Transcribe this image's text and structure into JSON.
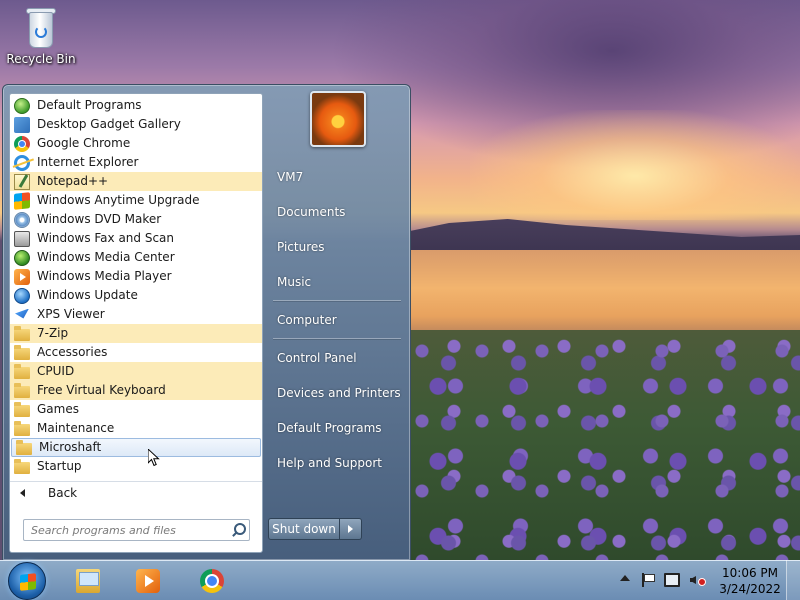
{
  "desktop": {
    "recycle_bin_label": "Recycle Bin"
  },
  "start_menu": {
    "programs": [
      {
        "label": "Default Programs",
        "icon": "default-programs-icon",
        "highlight": false
      },
      {
        "label": "Desktop Gadget Gallery",
        "icon": "gadget-gallery-icon",
        "highlight": false
      },
      {
        "label": "Google Chrome",
        "icon": "chrome-icon",
        "highlight": false
      },
      {
        "label": "Internet Explorer",
        "icon": "internet-explorer-icon",
        "highlight": false
      },
      {
        "label": "Notepad++",
        "icon": "notepad-plus-plus-icon",
        "highlight": true
      },
      {
        "label": "Windows Anytime Upgrade",
        "icon": "windows-flag-icon",
        "highlight": false
      },
      {
        "label": "Windows DVD Maker",
        "icon": "dvd-maker-icon",
        "highlight": false
      },
      {
        "label": "Windows Fax and Scan",
        "icon": "fax-scan-icon",
        "highlight": false
      },
      {
        "label": "Windows Media Center",
        "icon": "media-center-icon",
        "highlight": false
      },
      {
        "label": "Windows Media Player",
        "icon": "media-player-icon",
        "highlight": false
      },
      {
        "label": "Windows Update",
        "icon": "windows-update-icon",
        "highlight": false
      },
      {
        "label": "XPS Viewer",
        "icon": "xps-viewer-icon",
        "highlight": false
      },
      {
        "label": "7-Zip",
        "icon": "folder-icon",
        "highlight": true
      },
      {
        "label": "Accessories",
        "icon": "folder-icon",
        "highlight": false
      },
      {
        "label": "CPUID",
        "icon": "folder-icon",
        "highlight": true
      },
      {
        "label": "Free Virtual Keyboard",
        "icon": "folder-icon",
        "highlight": true
      },
      {
        "label": "Games",
        "icon": "folder-icon",
        "highlight": false
      },
      {
        "label": "Maintenance",
        "icon": "folder-icon",
        "highlight": false
      },
      {
        "label": "Microshaft",
        "icon": "folder-icon",
        "highlight": false,
        "hover": true
      },
      {
        "label": "Startup",
        "icon": "folder-icon",
        "highlight": false
      }
    ],
    "back_label": "Back",
    "search_placeholder": "Search programs and files",
    "right_pane": {
      "user_name": "VM7",
      "documents": "Documents",
      "pictures": "Pictures",
      "music": "Music",
      "computer": "Computer",
      "control_panel": "Control Panel",
      "devices_printers": "Devices and Printers",
      "default_programs": "Default Programs",
      "help_support": "Help and Support"
    },
    "shutdown_label": "Shut down"
  },
  "taskbar": {
    "pinned": [
      "windows-explorer-icon",
      "windows-media-player-icon",
      "chrome-icon"
    ],
    "clock": {
      "time": "10:06 PM",
      "date": "3/24/2022"
    }
  },
  "colors": {
    "highlight_new_program": "#fcebb8",
    "hover_item": "#dde9f7"
  }
}
